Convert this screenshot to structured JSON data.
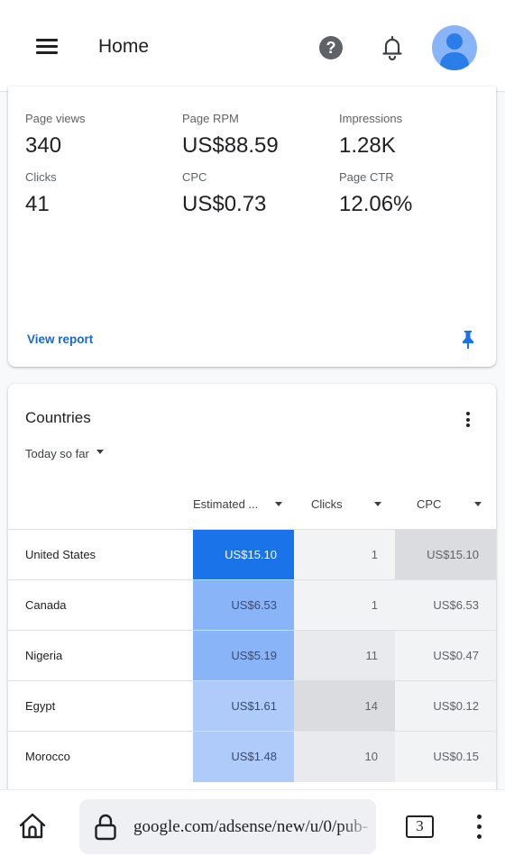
{
  "header": {
    "title": "Home",
    "menu_icon": "hamburger-menu-icon",
    "help_icon": "help-circle-icon",
    "help_glyph": "?",
    "notifications_icon": "bell-icon",
    "avatar_icon": "account-avatar-icon"
  },
  "metrics_card": {
    "metrics": [
      {
        "label": "Page views",
        "value": "340"
      },
      {
        "label": "Page RPM",
        "value": "US$88.59"
      },
      {
        "label": "Impressions",
        "value": "1.28K"
      },
      {
        "label": "Clicks",
        "value": "41"
      },
      {
        "label": "CPC",
        "value": "US$0.73"
      },
      {
        "label": "Page CTR",
        "value": "12.06%"
      }
    ],
    "view_report_label": "View report",
    "pin_icon": "pin-icon"
  },
  "countries_card": {
    "title": "Countries",
    "date_range": "Today so far",
    "columns": [
      "Estimated ...",
      "Clicks",
      "CPC"
    ],
    "rows": [
      {
        "country": "United States",
        "earnings": "US$15.10",
        "clicks": "1",
        "cpc": "US$15.10"
      },
      {
        "country": "Canada",
        "earnings": "US$6.53",
        "clicks": "1",
        "cpc": "US$6.53"
      },
      {
        "country": "Nigeria",
        "earnings": "US$5.19",
        "clicks": "11",
        "cpc": "US$0.47"
      },
      {
        "country": "Egypt",
        "earnings": "US$1.61",
        "clicks": "14",
        "cpc": "US$0.12"
      },
      {
        "country": "Morocco",
        "earnings": "US$1.48",
        "clicks": "10",
        "cpc": "US$0.15"
      }
    ],
    "heat_colors": {
      "earnings": [
        "#1a73e8",
        "#8ab4f8",
        "#8ab4f8",
        "#aecbfa",
        "#aecbfa"
      ],
      "earnings_text": [
        "#ffffff",
        "#3c4a6b",
        "#3c4a6b",
        "#3c4a6b",
        "#3c4a6b"
      ],
      "clicks": [
        "#f1f3f4",
        "#f1f3f4",
        "#e8eaed",
        "#dadce0",
        "#e8eaed"
      ],
      "cpc": [
        "#dadce0",
        "#f1f3f4",
        "#f1f3f4",
        "#f1f3f4",
        "#f1f3f4"
      ]
    }
  },
  "browser_bar": {
    "url": "google.com/adsense/new/u/0/pub-",
    "tab_count": "3",
    "home_icon": "home-icon",
    "lock_icon": "lock-icon",
    "overflow_icon": "more-vertical-icon"
  },
  "colors": {
    "accent": "#1a73e8",
    "link": "#1967d2"
  }
}
